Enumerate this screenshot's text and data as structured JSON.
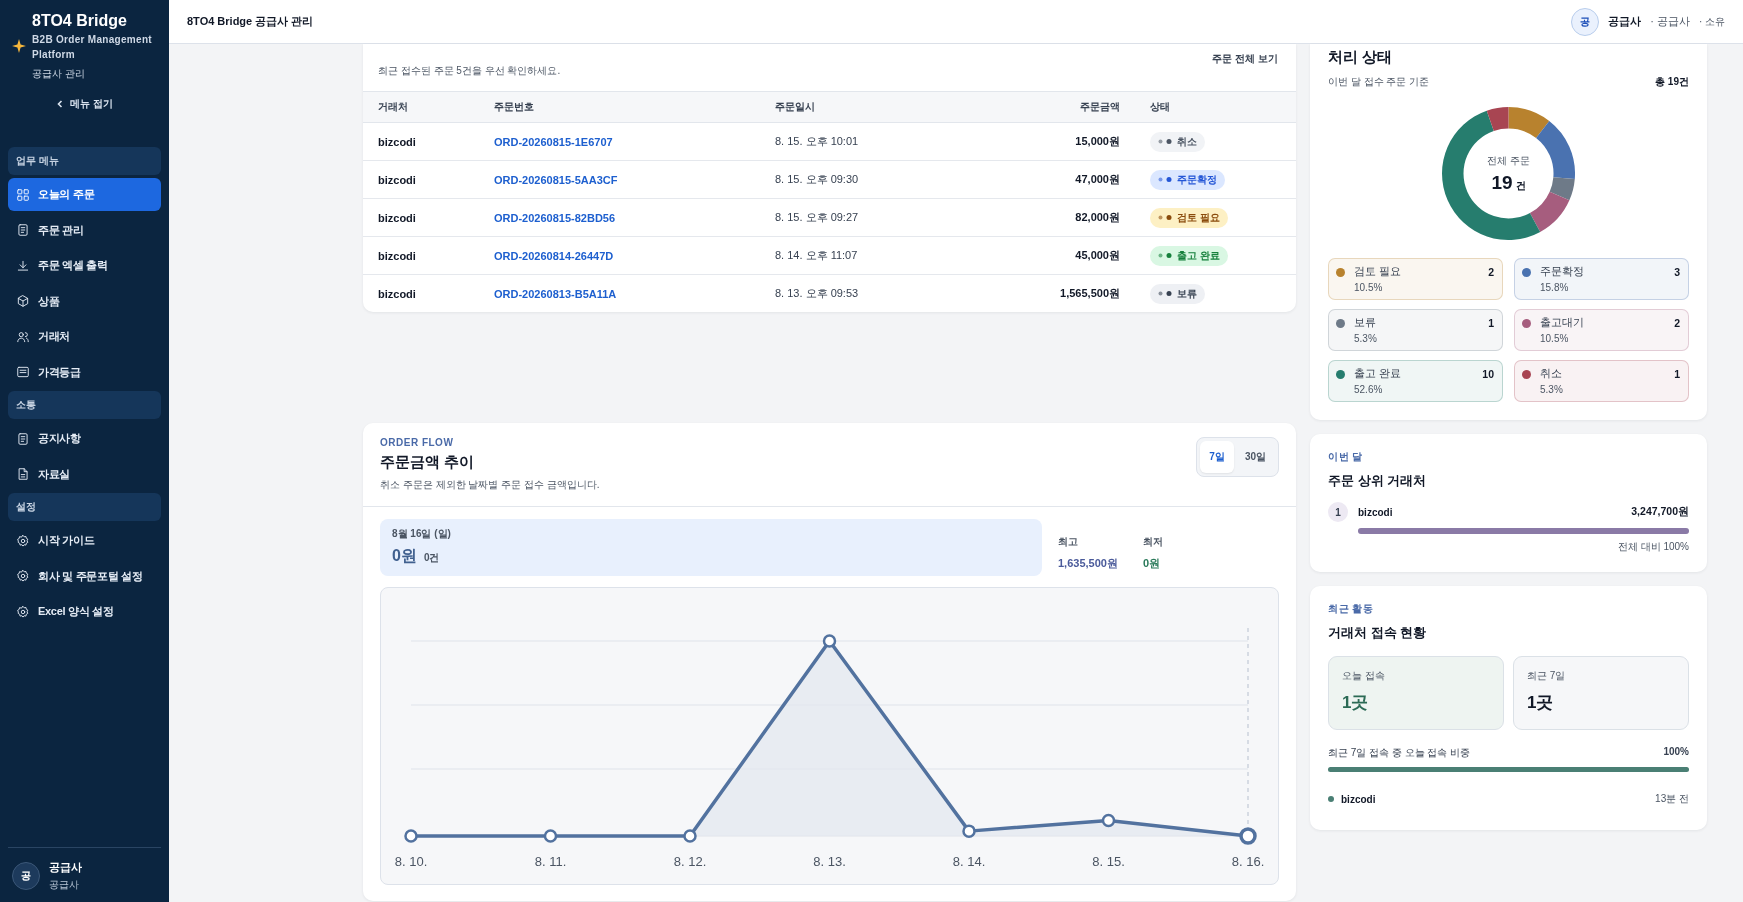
{
  "sidebar": {
    "brand": "8TO4 Bridge",
    "tagline": "B2B Order Management Platform",
    "subtitle": "공급사 관리",
    "collapse_label": "메뉴 접기",
    "sections": [
      {
        "title": "업무 메뉴",
        "items": [
          {
            "label": "오늘의 주문",
            "selected": true
          },
          {
            "label": "주문 관리",
            "selected": false
          },
          {
            "label": "주문 엑셀 출력",
            "selected": false
          },
          {
            "label": "상품",
            "selected": false
          },
          {
            "label": "거래처",
            "selected": false
          },
          {
            "label": "가격등급",
            "selected": false
          }
        ]
      },
      {
        "title": "소통",
        "items": [
          {
            "label": "공지사항",
            "selected": false
          },
          {
            "label": "자료실",
            "selected": false
          }
        ]
      },
      {
        "title": "설정",
        "items": [
          {
            "label": "시작 가이드",
            "selected": false
          },
          {
            "label": "회사 및 주문포털 설정",
            "selected": false
          },
          {
            "label": "Excel 양식 설정",
            "selected": false
          }
        ]
      }
    ],
    "user": {
      "avatar": "공",
      "name": "공급사",
      "role": "공급사"
    }
  },
  "header": {
    "title": "8TO4 Bridge 공급사 관리",
    "avatar": "공",
    "user_name": "공급사",
    "user_role": "· 공급사",
    "user_extra": "· 소유"
  },
  "recent_orders": {
    "subtitle": "최근 접수된 주문 5건을 우선 확인하세요.",
    "view_all": "주문 전체 보기",
    "columns": [
      "거래처",
      "주문번호",
      "주문일시",
      "주문금액",
      "상태"
    ],
    "rows": [
      {
        "customer": "bizcodi",
        "order_no": "ORD-20260815-1E6707",
        "ordered_at": "8. 15. 오후 10:01",
        "amount": "15,000원",
        "status": {
          "label": "취소",
          "kind": "cancelled"
        }
      },
      {
        "customer": "bizcodi",
        "order_no": "ORD-20260815-5AA3CF",
        "ordered_at": "8. 15. 오후 09:30",
        "amount": "47,000원",
        "status": {
          "label": "주문확정",
          "kind": "confirmed"
        }
      },
      {
        "customer": "bizcodi",
        "order_no": "ORD-20260815-82BD56",
        "ordered_at": "8. 15. 오후 09:27",
        "amount": "82,000원",
        "status": {
          "label": "검토 필요",
          "kind": "review"
        }
      },
      {
        "customer": "bizcodi",
        "order_no": "ORD-20260814-26447D",
        "ordered_at": "8. 14. 오후 11:07",
        "amount": "45,000원",
        "status": {
          "label": "출고 완료",
          "kind": "shipped"
        }
      },
      {
        "customer": "bizcodi",
        "order_no": "ORD-20260813-B5A11A",
        "ordered_at": "8. 13. 오후 09:53",
        "amount": "1,565,500원",
        "status": {
          "label": "보류",
          "kind": "hold"
        }
      }
    ]
  },
  "order_flow": {
    "eyebrow": "ORDER FLOW",
    "title": "주문금액 추이",
    "subtitle": "취소 주문은 제외한 날짜별 주문 접수 금액입니다.",
    "ranges": [
      {
        "label": "7일",
        "selected": true
      },
      {
        "label": "30일",
        "selected": false
      }
    ],
    "focus": {
      "date": "8월 16일 (일)",
      "amount": "0원",
      "count": "0건"
    },
    "stats": [
      {
        "label": "최고",
        "value": "1,635,500원",
        "kind": "max"
      },
      {
        "label": "최저",
        "value": "0원",
        "kind": "min"
      }
    ],
    "x_labels": [
      "8. 10.",
      "8. 11.",
      "8. 12.",
      "8. 13.",
      "8. 14.",
      "8. 15.",
      "8. 16."
    ]
  },
  "status_summary": {
    "title": "처리 상태",
    "subtitle": "이번 달 접수 주문 기준",
    "total": "총 19건",
    "center_label": "전체 주문",
    "center_value": "19",
    "center_unit": "건",
    "chart_data": {
      "type": "donut",
      "categories": [
        "검토 필요",
        "주문확정",
        "보류",
        "출고대기",
        "출고 완료",
        "취소"
      ],
      "values": [
        10.5,
        15.8,
        5.3,
        10.5,
        52.6,
        5.3
      ]
    },
    "legend": [
      {
        "count": "2",
        "percent": "10.5%",
        "color": "#b8822e"
      },
      {
        "count": "3",
        "percent": "15.8%",
        "color": "#4a72b0"
      },
      {
        "count": "1",
        "percent": "5.3%",
        "color": "#6e7a88"
      },
      {
        "count": "2",
        "percent": "10.5%",
        "color": "#a65d7e"
      },
      {
        "count": "10",
        "percent": "52.6%",
        "color": "#267d6e"
      },
      {
        "count": "1",
        "percent": "5.3%",
        "color": "#a84552"
      }
    ]
  },
  "top_customers": {
    "eyebrow": "이번 달",
    "title": "주문 상위 거래처",
    "items": [
      {
        "rank": "1",
        "name": "bizcodi",
        "amount": "3,247,700원",
        "level": 1,
        "share": "전체 대비 100%"
      }
    ]
  },
  "partner_access": {
    "eyebrow": "최근 활동",
    "title": "거래처 접속 현황",
    "tiles": [
      {
        "label": "오늘 접속",
        "value": "1곳",
        "kind": "today"
      },
      {
        "label": "최근 7일",
        "value": "1곳",
        "kind": "week"
      }
    ],
    "ratio_label": "최근 7일 접속 중 오늘 접속 비중",
    "ratio_value": "100%",
    "level": 1,
    "partners": [
      {
        "name": "bizcodi",
        "time": "13분 전"
      }
    ]
  }
}
